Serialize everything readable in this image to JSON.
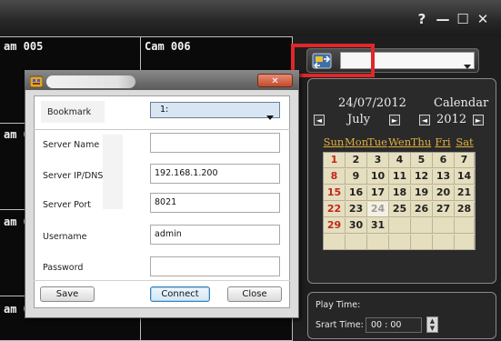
{
  "window": {
    "help_label": "?",
    "minimize_label": "—",
    "maximize_label": "☐",
    "close_label": "✕"
  },
  "cameras": [
    {
      "label": "am 005"
    },
    {
      "label": "Cam 006"
    },
    {
      "label": "am 0"
    },
    {
      "label": "am 0"
    },
    {
      "label": "am 0"
    }
  ],
  "calendar": {
    "date_label": "24/07/2012",
    "title": "Calendar",
    "month": "July",
    "year": "2012",
    "weekdays": [
      "Sun",
      "Mon",
      "Tue",
      "Wen",
      "Thu",
      "Fri",
      "Sat"
    ],
    "weeks": [
      [
        "1",
        "2",
        "3",
        "4",
        "5",
        "6",
        "7"
      ],
      [
        "8",
        "9",
        "10",
        "11",
        "12",
        "13",
        "14"
      ],
      [
        "15",
        "16",
        "17",
        "18",
        "19",
        "20",
        "21"
      ],
      [
        "22",
        "23",
        "24",
        "25",
        "26",
        "27",
        "28"
      ],
      [
        "29",
        "30",
        "31",
        "",
        "",
        "",
        ""
      ],
      [
        "",
        "",
        "",
        "",
        "",
        "",
        ""
      ]
    ],
    "selected_day": "24",
    "prev_label": "◄",
    "next_label": "►"
  },
  "play_panel": {
    "play_time_label": "Play Time:",
    "start_time_label": "Srart Time:",
    "start_time_value": "00 : 00"
  },
  "dialog": {
    "bookmark_label": "Bookmark",
    "bookmark_value": "1:",
    "close_label": "✕",
    "server_name_label": "Server Name",
    "server_name_value": "",
    "server_ip_label": "Server IP/DNS",
    "server_ip_value": "192.168.1.200",
    "server_port_label": "Server Port",
    "server_port_value": "8021",
    "username_label": "Username",
    "username_value": "admin",
    "password_label": "Password",
    "password_value": "",
    "save_label": "Save",
    "connect_label": "Connect",
    "cancel_label": "Close"
  },
  "colors": {
    "highlight": "#e0272b",
    "weekday_header": "#e0b040",
    "weekend_red": "#c0281c"
  }
}
